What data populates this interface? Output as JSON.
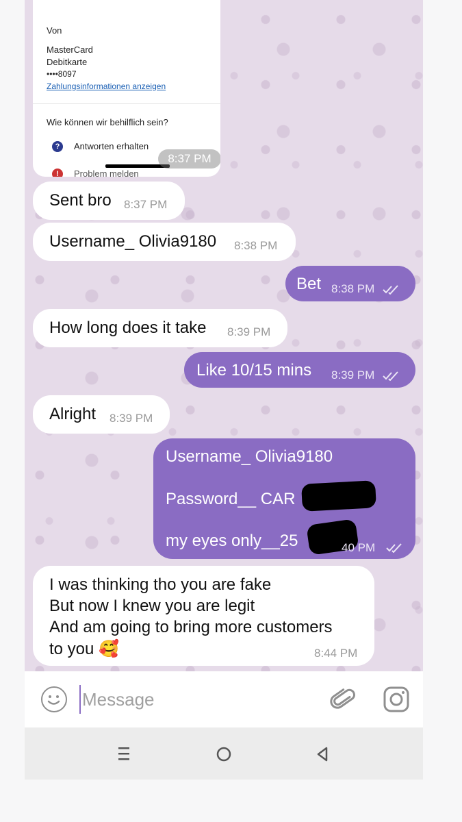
{
  "payment_card": {
    "from_label": "Von",
    "card_name_line1": "MasterCard",
    "card_name_line2": "Debitkarte",
    "card_number": "••••8097",
    "payment_info_link": "Zahlungsinformationen anzeigen",
    "help_title": "Wie können wir behilflich sein?",
    "help_option_1": "Antworten erhalten",
    "help_option_2": "Problem melden",
    "time": "8:37 PM"
  },
  "messages": [
    {
      "direction": "incoming",
      "text": "Sent bro",
      "time": "8:37 PM"
    },
    {
      "direction": "incoming",
      "text": "Username_ Olivia9180",
      "time": "8:38 PM"
    },
    {
      "direction": "outgoing",
      "text": "Bet",
      "time": "8:38 PM",
      "status": "read"
    },
    {
      "direction": "incoming",
      "text": "How long does it take",
      "time": "8:39 PM"
    },
    {
      "direction": "outgoing",
      "text": "Like 10/15 mins",
      "time": "8:39 PM",
      "status": "read"
    },
    {
      "direction": "incoming",
      "text": "Alright",
      "time": "8:39 PM"
    },
    {
      "direction": "outgoing",
      "lines": [
        "Username_ Olivia9180",
        "Password__ CAR",
        "my eyes only__25"
      ],
      "time": "40 PM",
      "status": "read"
    },
    {
      "direction": "incoming",
      "lines": [
        "I was thinking tho you are fake",
        "But now I knew you are legit",
        "And am going to bring more customers",
        "to you 🥰"
      ],
      "time": "8:44 PM"
    }
  ],
  "input_bar": {
    "placeholder": "Message",
    "emoji_icon": "smiley-icon",
    "attach_icon": "paperclip-icon",
    "camera_icon": "instagram-camera-icon"
  },
  "nav_bar": {
    "icons": [
      "recents-icon",
      "home-icon",
      "back-icon"
    ]
  },
  "colors": {
    "outgoing_bubble": "#8a6cc3",
    "incoming_bubble": "#ffffff",
    "chat_background": "#e6dbe9"
  }
}
